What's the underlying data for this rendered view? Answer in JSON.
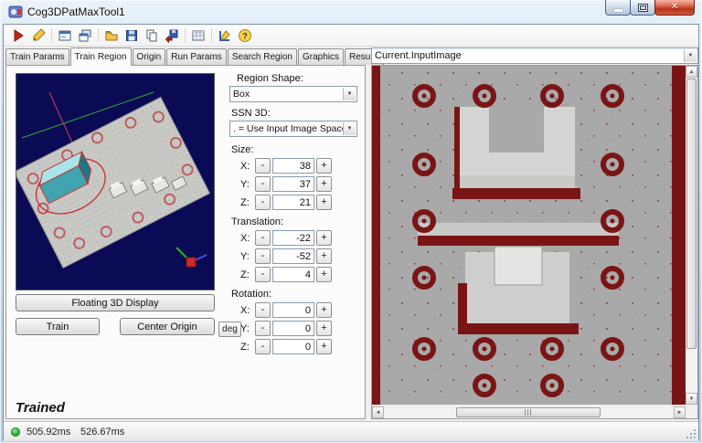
{
  "window": {
    "title": "Cog3DPatMaxTool1"
  },
  "toolbar": {
    "icons": [
      {
        "name": "run-icon"
      },
      {
        "name": "auto-run-icon"
      },
      {
        "name": "local-display-icon"
      },
      {
        "name": "floating-display-icon"
      },
      {
        "name": "open-icon"
      },
      {
        "name": "save-icon"
      },
      {
        "name": "copy-icon"
      },
      {
        "name": "save-as-icon"
      },
      {
        "name": "table-icon"
      },
      {
        "name": "tools-icon"
      },
      {
        "name": "help-icon"
      }
    ]
  },
  "tabs": {
    "items": [
      {
        "label": "Train Params",
        "active": false
      },
      {
        "label": "Train Region",
        "active": true
      },
      {
        "label": "Origin",
        "active": false
      },
      {
        "label": "Run Params",
        "active": false
      },
      {
        "label": "Search Region",
        "active": false
      },
      {
        "label": "Graphics",
        "active": false
      },
      {
        "label": "Results",
        "active": false
      }
    ]
  },
  "left_panel": {
    "floating_button": "Floating 3D Display",
    "train_button": "Train",
    "center_origin_button": "Center Origin"
  },
  "controls": {
    "region_shape_label": "Region Shape:",
    "region_shape_value": "Box",
    "ssn_label": "SSN 3D:",
    "ssn_value": ". = Use Input Image Space",
    "size_label": "Size:",
    "translation_label": "Translation:",
    "rotation_label": "Rotation:",
    "deg_label": "deg",
    "axis_x": "X:",
    "axis_y": "Y:",
    "axis_z": "Z:",
    "minus_label": "-",
    "plus_label": "+",
    "size": {
      "x": "38",
      "y": "37",
      "z": "21"
    },
    "translation": {
      "x": "-22",
      "y": "-52",
      "z": "4"
    },
    "rotation": {
      "x": "0",
      "y": "0",
      "z": "0"
    }
  },
  "right_panel": {
    "selector_value": "Current.InputImage"
  },
  "status": {
    "trained_label": "Trained",
    "time_total": "505.92ms",
    "time_last": "526.67ms"
  },
  "colors": {
    "titlebar_blue": "#bdd3ea",
    "view_background": "#0b0b55",
    "image_background": "#a9a9a9",
    "feature_maroon": "#7a1515",
    "region_box_teal": "#2f9fae",
    "region_outline_red": "#cc2b2b",
    "status_green": "#35b235"
  }
}
